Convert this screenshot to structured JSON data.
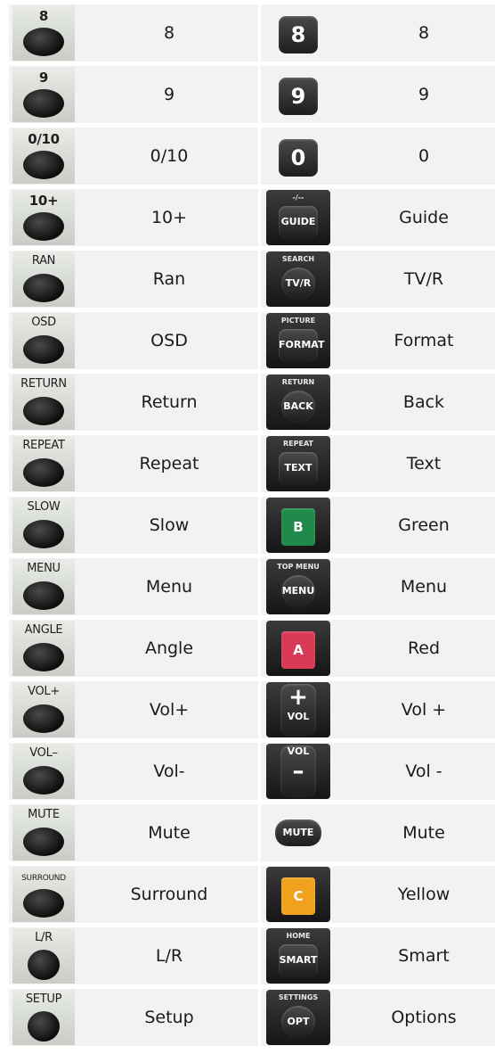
{
  "rows": [
    {
      "left": {
        "cap": "8",
        "label": "8"
      },
      "right": {
        "cap": "",
        "key": "8",
        "kind": "digit",
        "label": "8"
      }
    },
    {
      "left": {
        "cap": "9",
        "label": "9"
      },
      "right": {
        "cap": "",
        "key": "9",
        "kind": "digit",
        "label": "9"
      }
    },
    {
      "left": {
        "cap": "0/10",
        "label": "0/10"
      },
      "right": {
        "cap": "",
        "key": "0",
        "kind": "digit",
        "label": "0"
      }
    },
    {
      "left": {
        "cap": "10+",
        "label": "10+"
      },
      "right": {
        "cap": "-/--",
        "key": "GUIDE",
        "kind": "std",
        "label": "Guide"
      }
    },
    {
      "left": {
        "cap": "RAN",
        "label": "Ran"
      },
      "right": {
        "cap": "SEARCH",
        "key": "TV/R",
        "kind": "roundk",
        "label": "TV/R"
      }
    },
    {
      "left": {
        "cap": "OSD",
        "label": "OSD"
      },
      "right": {
        "cap": "PICTURE",
        "key": "FORMAT",
        "kind": "std",
        "label": "Format"
      }
    },
    {
      "left": {
        "cap": "RETURN",
        "label": "Return"
      },
      "right": {
        "cap": "RETURN",
        "key": "BACK",
        "kind": "roundk",
        "label": "Back"
      }
    },
    {
      "left": {
        "cap": "REPEAT",
        "label": "Repeat"
      },
      "right": {
        "cap": "REPEAT",
        "key": "TEXT",
        "kind": "std",
        "label": "Text"
      }
    },
    {
      "left": {
        "cap": "SLOW",
        "label": "Slow"
      },
      "right": {
        "cap": "",
        "key": "B",
        "kind": "color",
        "color": "#1f8a4a",
        "label": "Green"
      }
    },
    {
      "left": {
        "cap": "MENU",
        "label": "Menu"
      },
      "right": {
        "cap": "TOP MENU",
        "key": "MENU",
        "kind": "roundk",
        "label": "Menu"
      }
    },
    {
      "left": {
        "cap": "ANGLE",
        "label": "Angle"
      },
      "right": {
        "cap": "",
        "key": "A",
        "kind": "color",
        "color": "#d83a55",
        "label": "Red"
      }
    },
    {
      "left": {
        "cap": "VOL+",
        "label": "Vol+"
      },
      "right": {
        "cap": "",
        "key": "+",
        "sub": "VOL",
        "kind": "volplus",
        "label": "Vol +"
      }
    },
    {
      "left": {
        "cap": "VOL–",
        "label": "Vol-"
      },
      "right": {
        "cap": "",
        "key": "–",
        "sub": "VOL",
        "kind": "volminus",
        "label": "Vol -"
      }
    },
    {
      "left": {
        "cap": "MUTE",
        "label": "Mute"
      },
      "right": {
        "cap": "",
        "key": "MUTE",
        "kind": "pill",
        "label": "Mute"
      }
    },
    {
      "left": {
        "cap": "SURROUND",
        "label": "Surround"
      },
      "right": {
        "cap": "",
        "key": "C",
        "kind": "color",
        "color": "#f0a21e",
        "label": "Yellow"
      }
    },
    {
      "left": {
        "cap": "L/R",
        "label": "L/R"
      },
      "right": {
        "cap": "HOME",
        "key": "SMART",
        "kind": "std",
        "label": "Smart"
      }
    },
    {
      "left": {
        "cap": "SETUP",
        "label": "Setup"
      },
      "right": {
        "cap": "SETTINGS",
        "key": "OPT",
        "kind": "roundk",
        "label": "Options"
      }
    }
  ]
}
